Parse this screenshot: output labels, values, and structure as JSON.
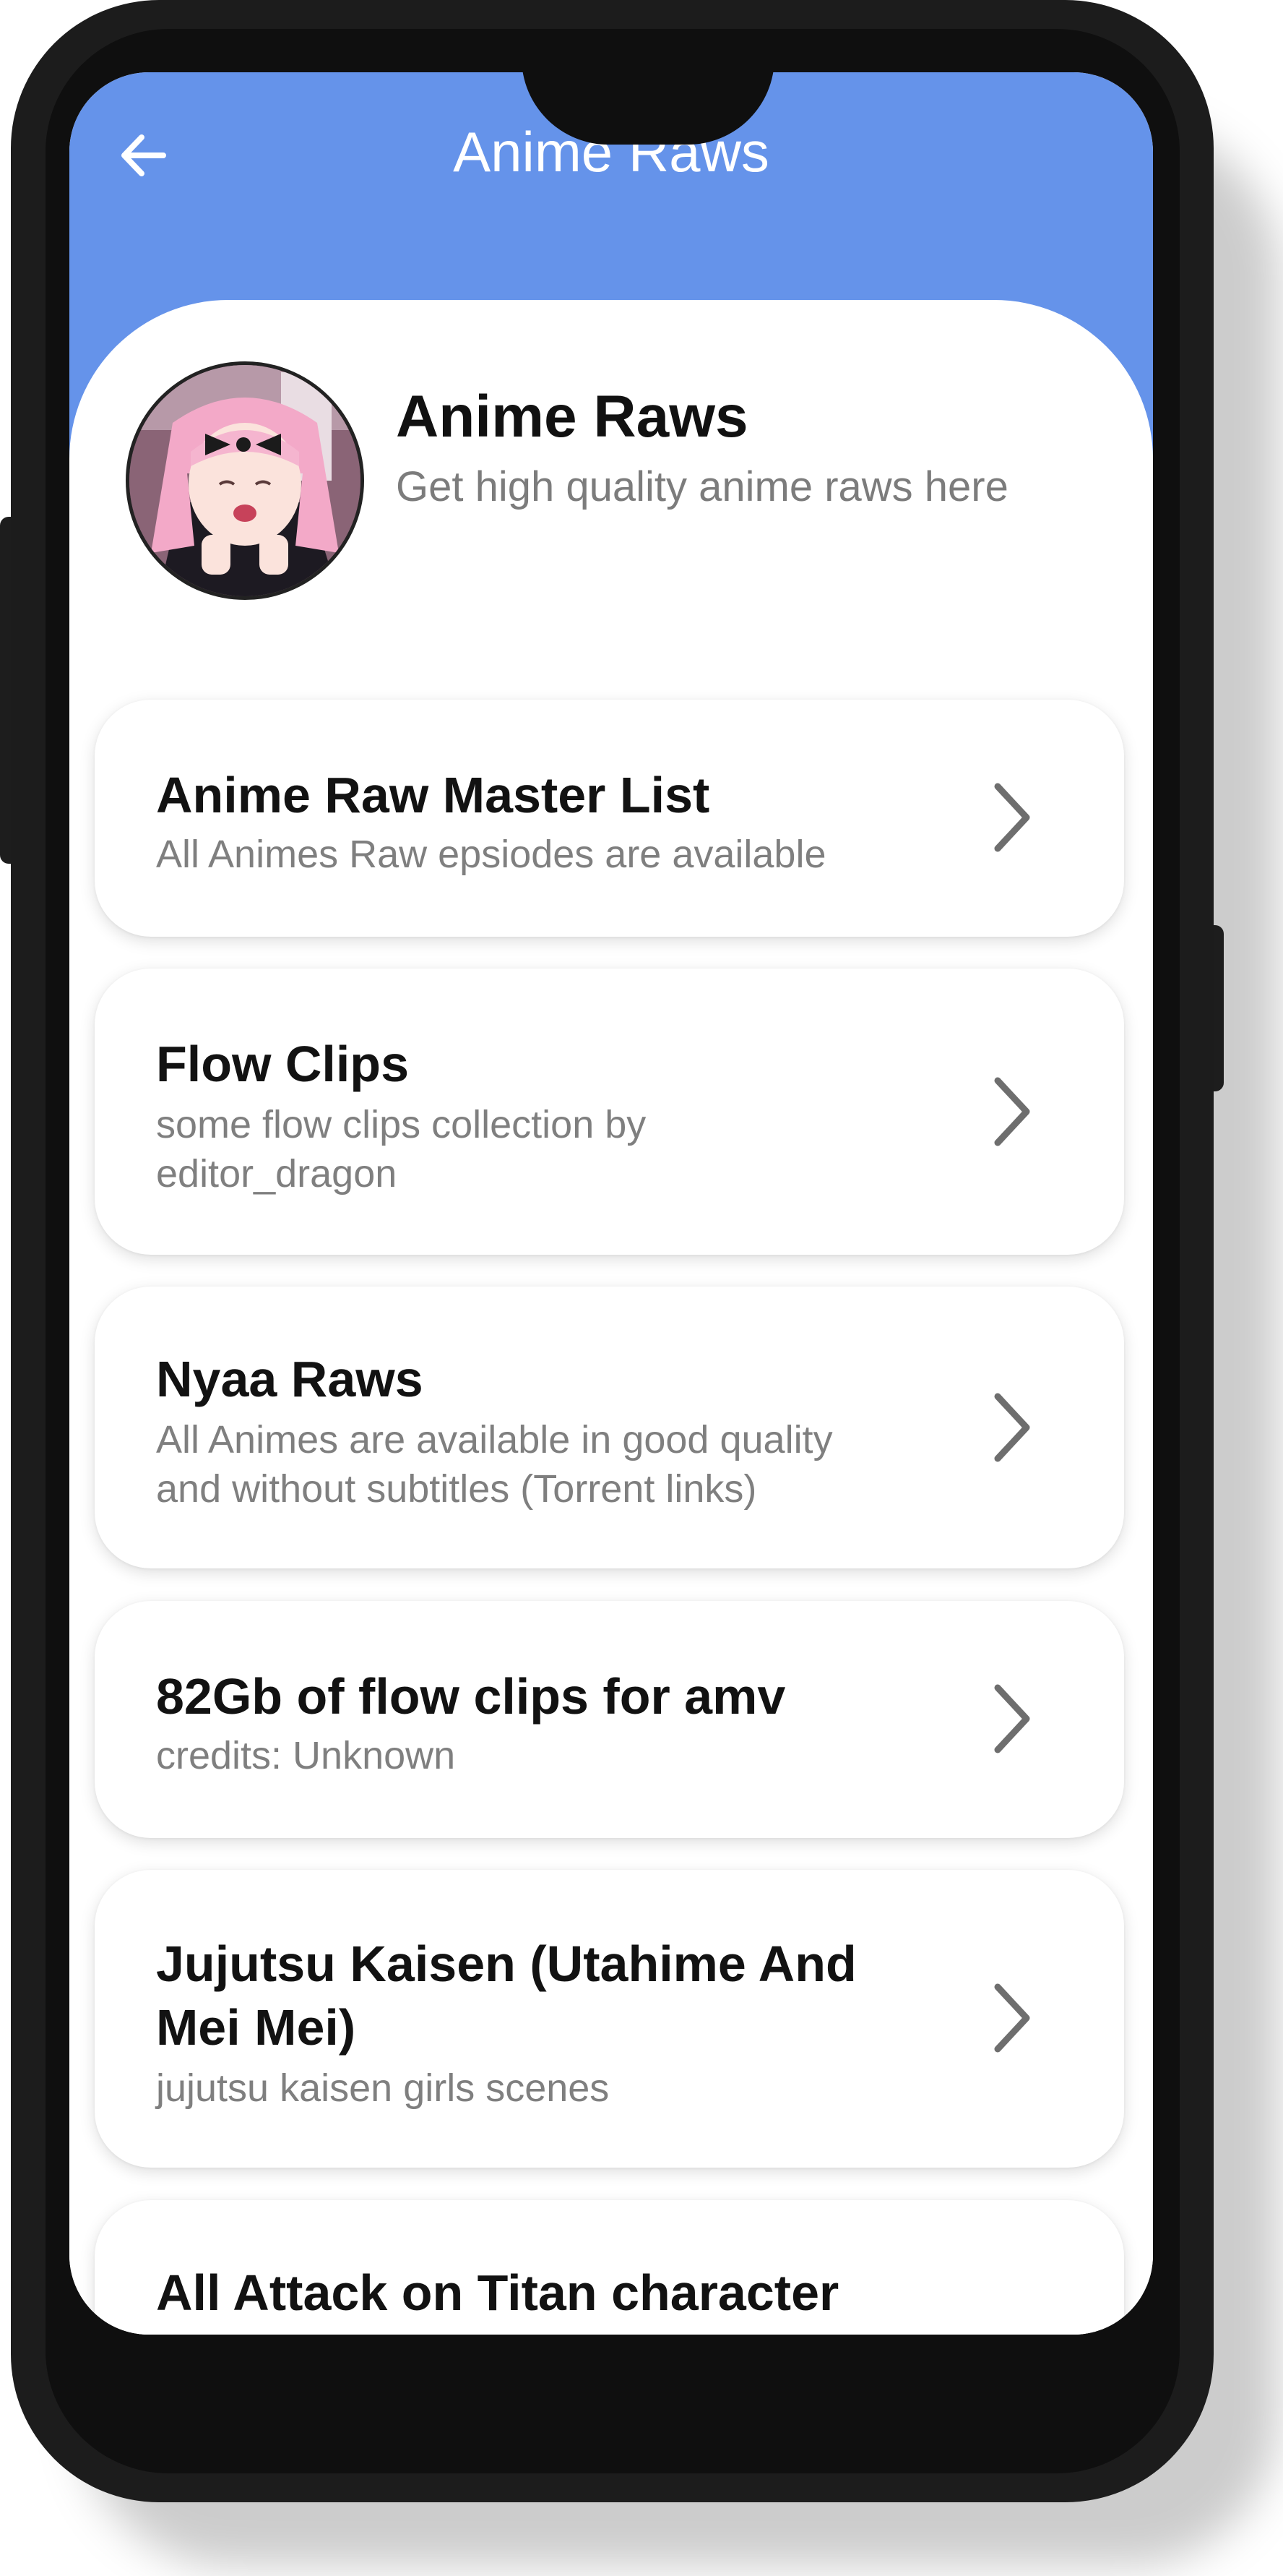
{
  "appbar": {
    "title": "Anime Raws",
    "back_icon": "arrow-left-icon"
  },
  "profile": {
    "name": "Anime Raws",
    "subtitle": "Get high quality anime raws here"
  },
  "items": [
    {
      "title": "Anime Raw Master List",
      "subtitle": "All Animes Raw epsiodes are available"
    },
    {
      "title": "Flow Clips",
      "subtitle": "some flow clips collection by editor_dragon"
    },
    {
      "title": "Nyaa Raws",
      "subtitle": "All Animes are available in good quality and without subtitles (Torrent links)"
    },
    {
      "title": "82Gb of flow clips for amv",
      "subtitle": "credits: Unknown"
    },
    {
      "title": "Jujutsu Kaisen (Utahime And Mei Mei)",
      "subtitle": "jujutsu kaisen girls scenes"
    },
    {
      "title": "All Attack on Titan character",
      "subtitle": ""
    }
  ],
  "colors": {
    "accent": "#6593ea",
    "phone_frame": "#1c1c1c",
    "text_primary": "#121212",
    "text_secondary": "#7f7f7f"
  }
}
